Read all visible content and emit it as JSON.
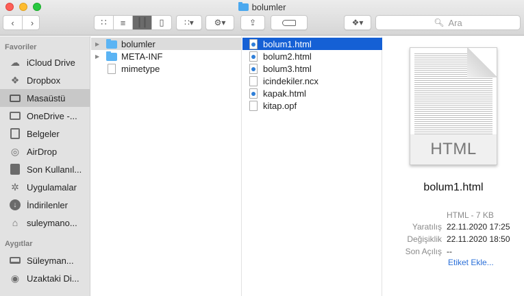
{
  "window": {
    "title": "bolumler"
  },
  "toolbar": {
    "view_modes": [
      "icon-view",
      "list-view",
      "column-view",
      "gallery-view"
    ],
    "active_view": 2,
    "search_placeholder": "Ara"
  },
  "sidebar": {
    "sections": [
      {
        "title": "Favoriler",
        "items": [
          {
            "label": "iCloud Drive",
            "icon": "cloud-icon"
          },
          {
            "label": "Dropbox",
            "icon": "dropbox-icon"
          },
          {
            "label": "Masaüstü",
            "icon": "desktop-icon",
            "selected": true
          },
          {
            "label": "OneDrive -...",
            "icon": "folder-icon"
          },
          {
            "label": "Belgeler",
            "icon": "document-icon"
          },
          {
            "label": "AirDrop",
            "icon": "airdrop-icon"
          },
          {
            "label": "Son Kullanıl...",
            "icon": "recents-icon"
          },
          {
            "label": "Uygulamalar",
            "icon": "applications-icon"
          },
          {
            "label": "İndirilenler",
            "icon": "downloads-icon"
          },
          {
            "label": "suleymano...",
            "icon": "home-icon"
          }
        ]
      },
      {
        "title": "Aygıtlar",
        "items": [
          {
            "label": "Süleyman...",
            "icon": "laptop-icon"
          },
          {
            "label": "Uzaktaki Di...",
            "icon": "disc-icon"
          }
        ]
      }
    ]
  },
  "column1": {
    "items": [
      {
        "name": "bolumler",
        "type": "folder",
        "selected": true
      },
      {
        "name": "META-INF",
        "type": "folder"
      },
      {
        "name": "mimetype",
        "type": "file"
      }
    ]
  },
  "column2": {
    "items": [
      {
        "name": "bolum1.html",
        "type": "html",
        "selected": true
      },
      {
        "name": "bolum2.html",
        "type": "html"
      },
      {
        "name": "bolum3.html",
        "type": "html"
      },
      {
        "name": "icindekiler.ncx",
        "type": "file"
      },
      {
        "name": "kapak.html",
        "type": "html"
      },
      {
        "name": "kitap.opf",
        "type": "file"
      }
    ]
  },
  "preview": {
    "thumb_label": "HTML",
    "name": "bolum1.html",
    "kind_size": "HTML - 7 KB",
    "meta": [
      {
        "key": "Yaratılış",
        "value": "22.11.2020 17:25"
      },
      {
        "key": "Değişiklik",
        "value": "22.11.2020 18:50"
      },
      {
        "key": "Son Açılış",
        "value": "--"
      }
    ],
    "tags_link": "Etiket Ekle..."
  },
  "colors": {
    "selection": "#1560d5",
    "folder": "#5bb4f4",
    "sidebar_bg": "#e2e2e2"
  }
}
